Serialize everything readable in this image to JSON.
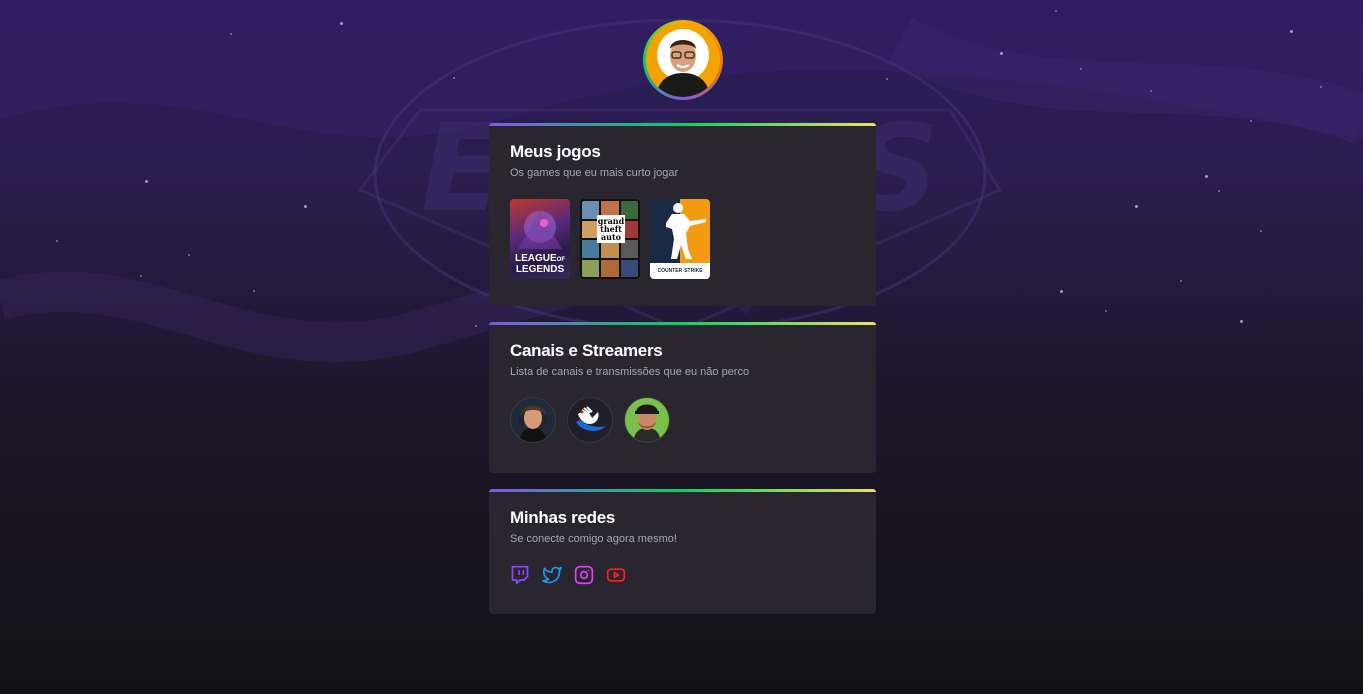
{
  "profile": {
    "avatar_icon": "profile-avatar-photo"
  },
  "cards": {
    "games": {
      "title": "Meus jogos",
      "subtitle": "Os games que eu mais curto jogar",
      "items": [
        {
          "name": "League of Legends",
          "label_line1": "LEAGUE",
          "label_of": "OF",
          "label_line2": "LEGENDS"
        },
        {
          "name": "Grand Theft Auto V",
          "label_line1": "grand",
          "label_line2": "theft",
          "label_line3": "auto"
        },
        {
          "name": "Counter-Strike",
          "label_line1": "COUNTER",
          "label_line2": "STRIKE"
        }
      ]
    },
    "streamers": {
      "title": "Canais e Streamers",
      "subtitle": "Lista de canais e transmissões que eu não perco",
      "items": [
        {
          "icon": "streamer-avatar-1"
        },
        {
          "icon": "streamer-avatar-2-winged-logo"
        },
        {
          "icon": "streamer-avatar-3"
        }
      ]
    },
    "socials": {
      "title": "Minhas redes",
      "subtitle": "Se conecte comigo agora mesmo!",
      "items": [
        {
          "icon": "twitch-icon",
          "color": "#9147ff"
        },
        {
          "icon": "twitter-icon",
          "color": "#1d9bf0"
        },
        {
          "icon": "instagram-icon",
          "color": "#e040fb"
        },
        {
          "icon": "youtube-icon",
          "color": "#ff2020"
        }
      ]
    }
  },
  "colors": {
    "card_bg": "#29262f",
    "accent_gradient": [
      "#8257e5",
      "#04d361",
      "#f0e060"
    ]
  }
}
